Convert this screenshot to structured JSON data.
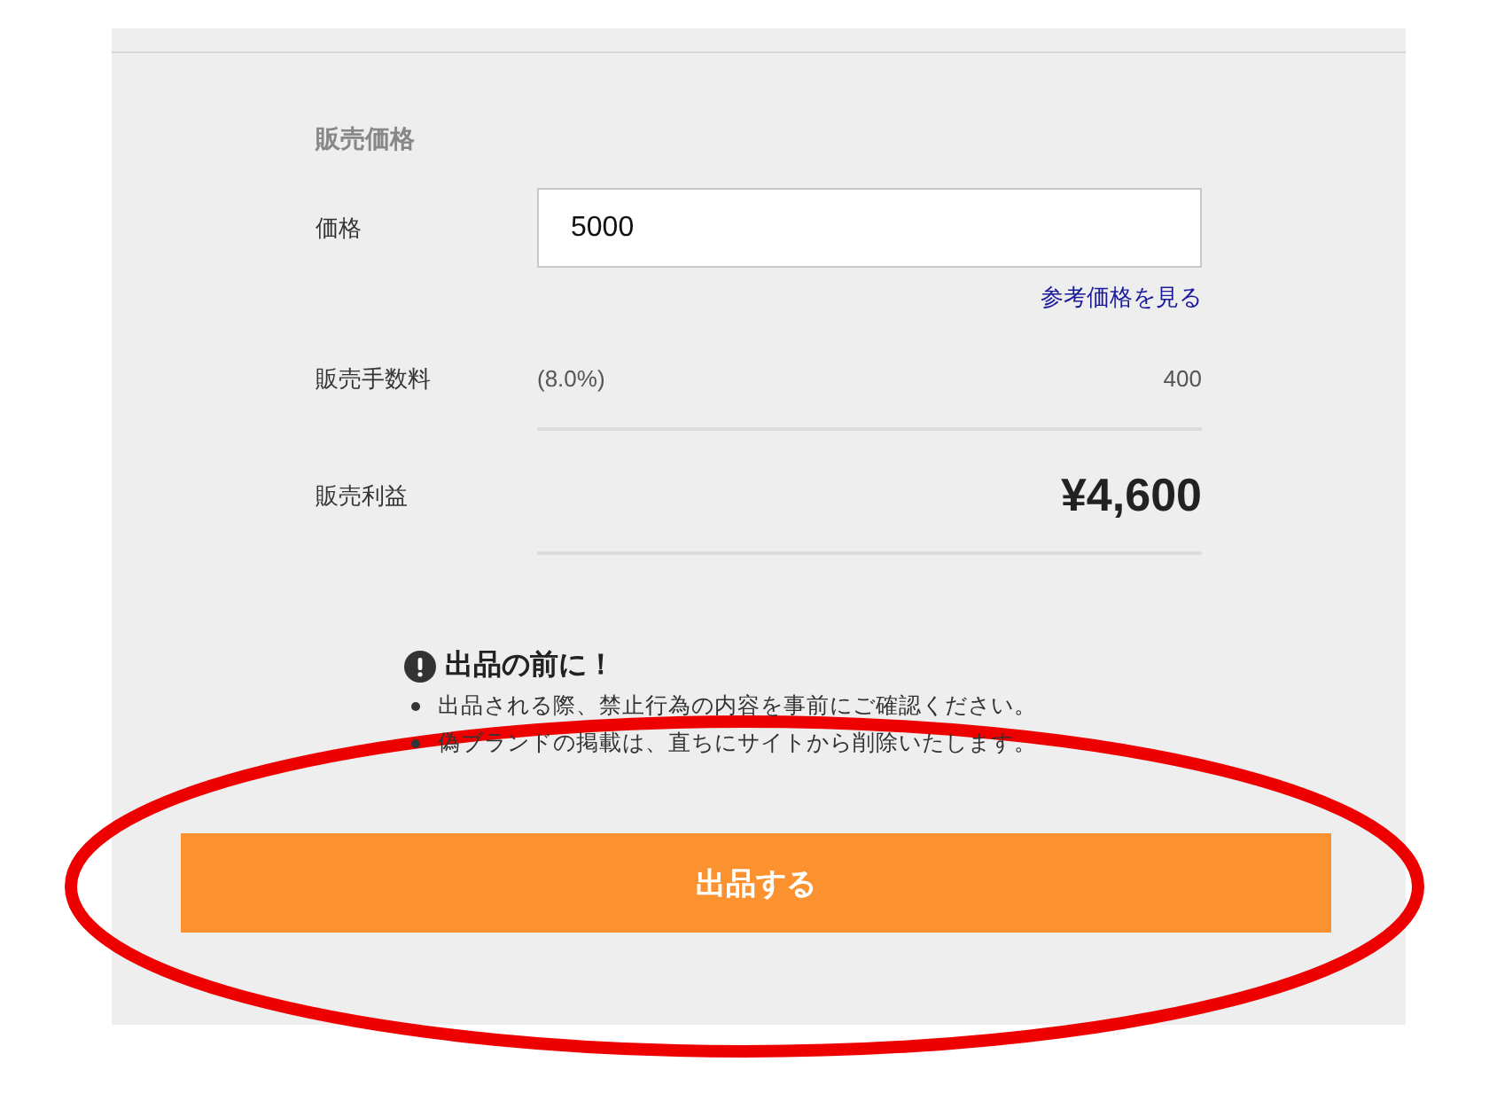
{
  "section_title": "販売価格",
  "price": {
    "label": "価格",
    "value": "5000"
  },
  "reference_link": "参考価格を見る",
  "fee": {
    "label": "販売手数料",
    "rate": "(8.0%)",
    "amount": "400"
  },
  "profit": {
    "label": "販売利益",
    "amount": "¥4,600"
  },
  "notice": {
    "title": "出品の前に！",
    "items": [
      "出品される際、禁止行為の内容を事前にご確認ください。",
      "偽ブランドの掲載は、直ちにサイトから削除いたします。"
    ]
  },
  "submit_button": "出品する"
}
